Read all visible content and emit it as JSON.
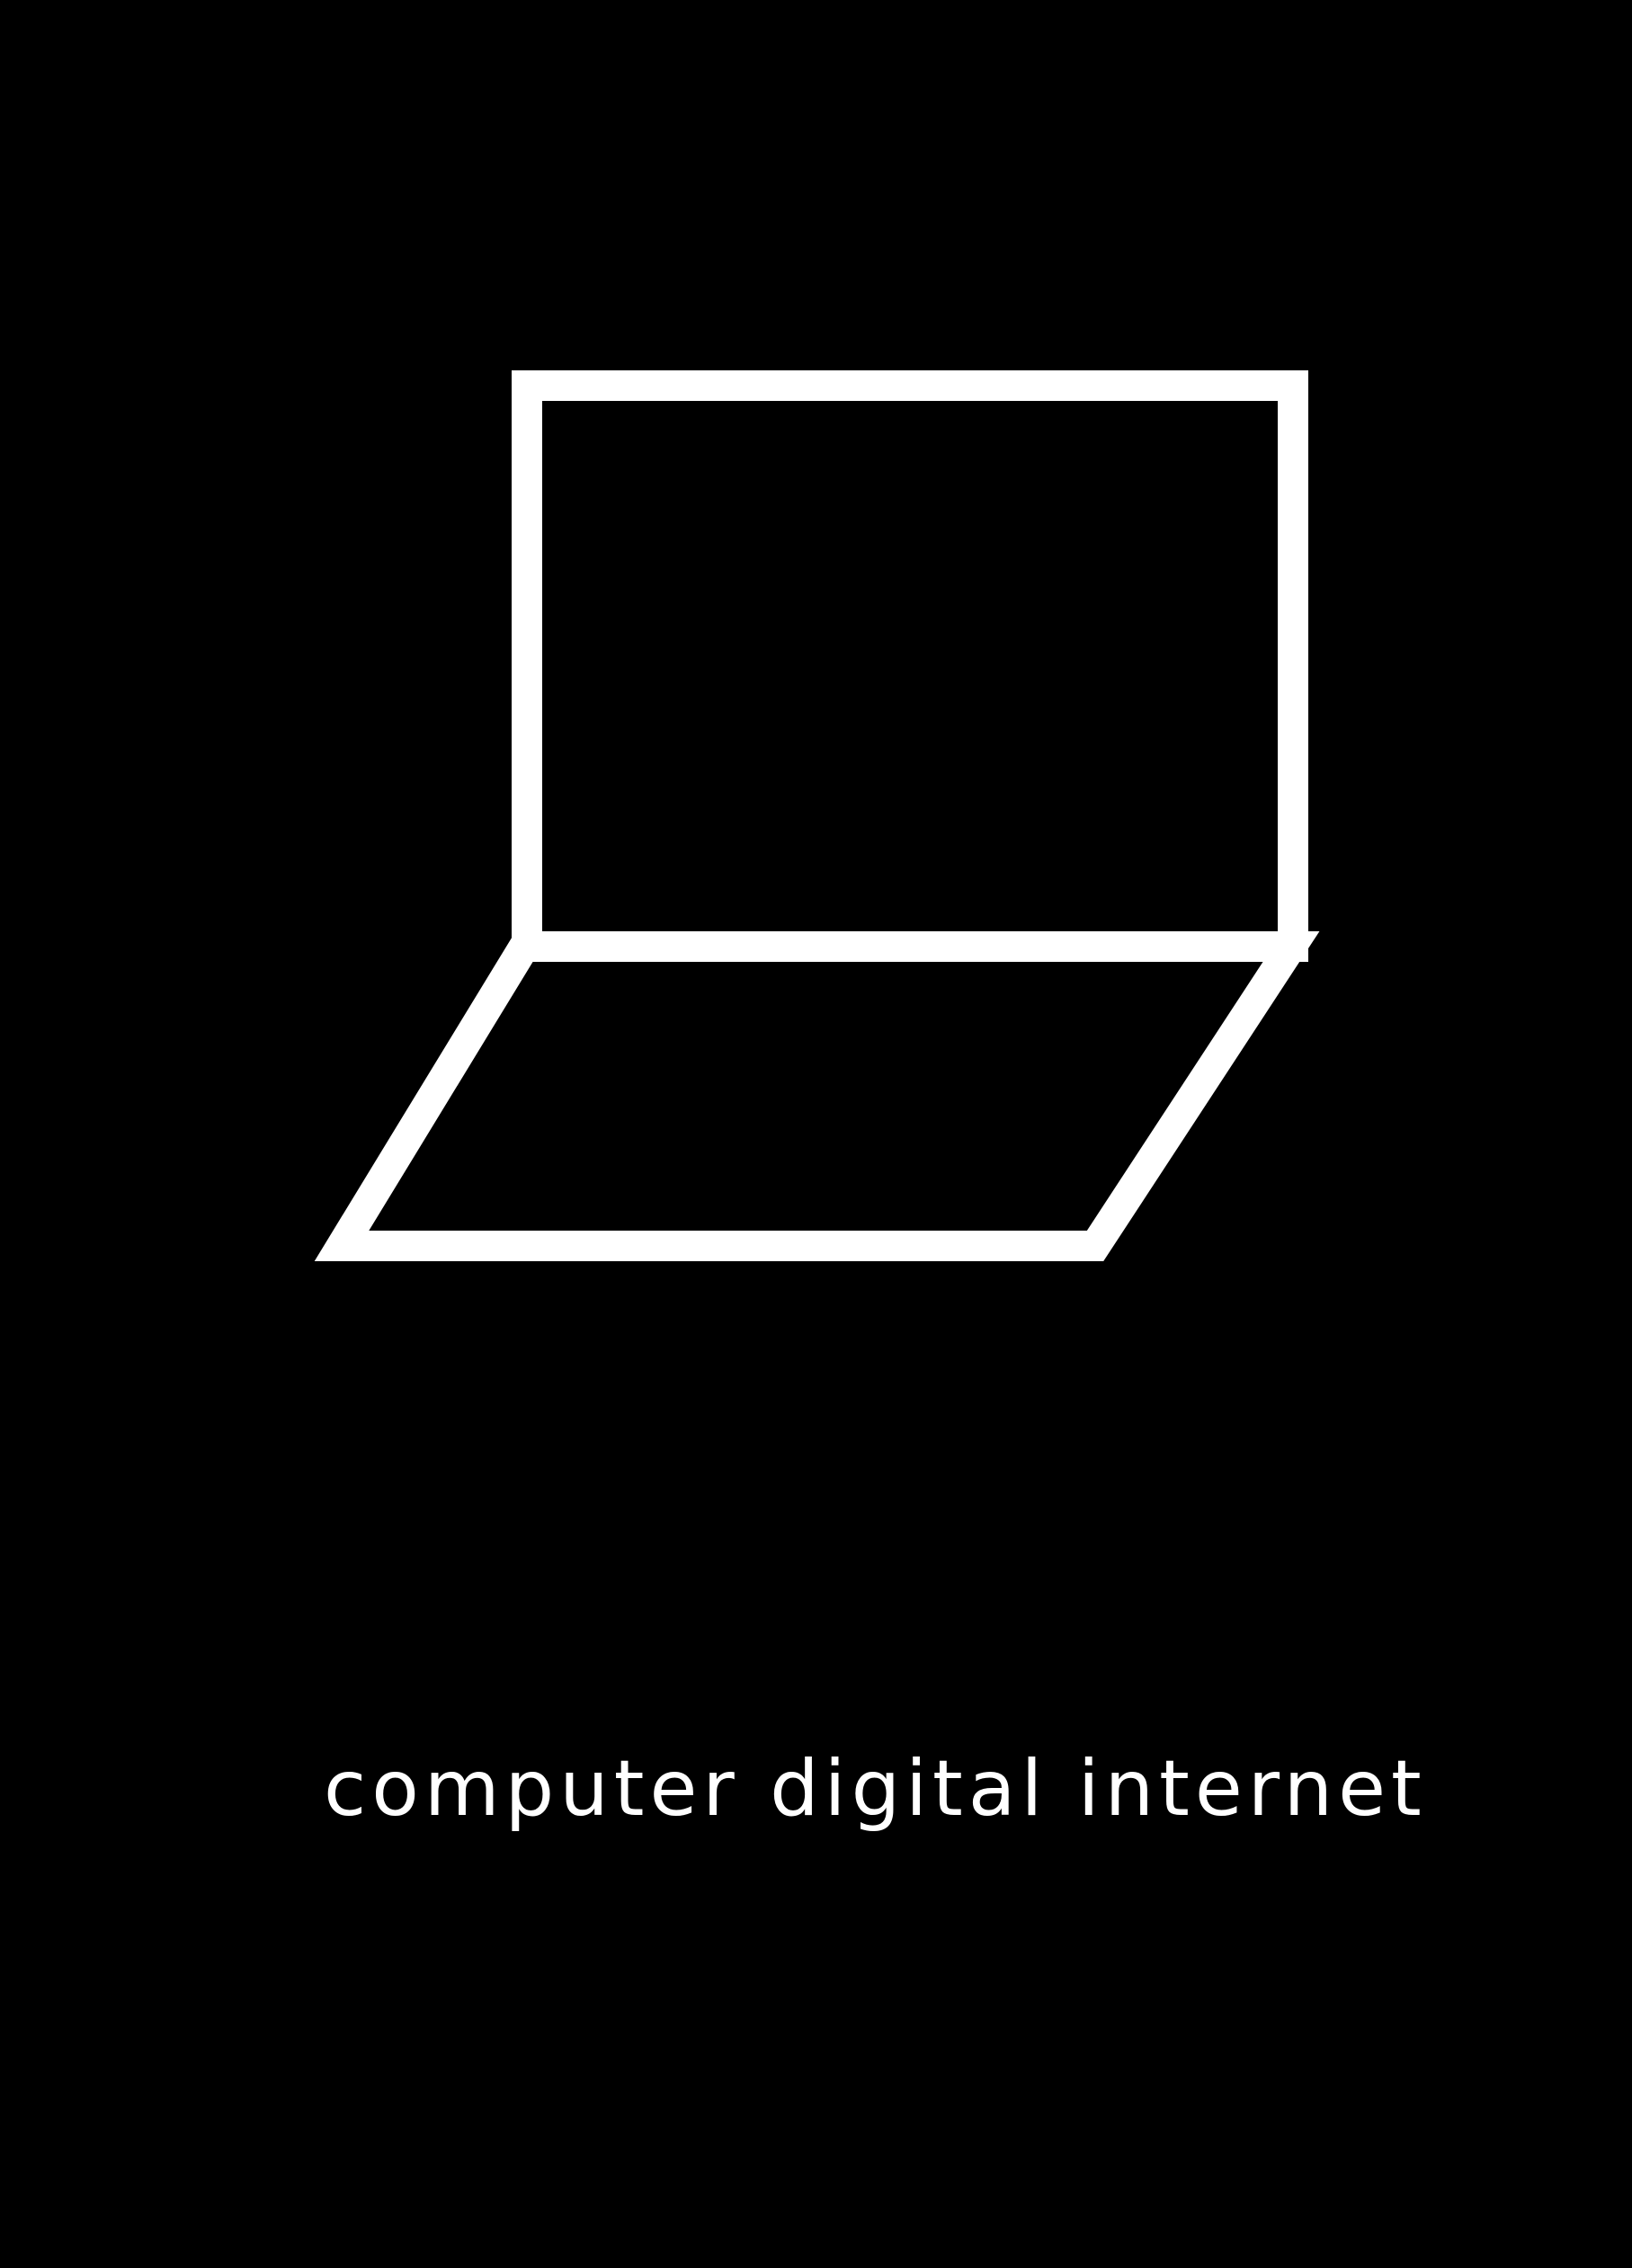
{
  "caption": "computer digital internet",
  "icon": "laptop-icon",
  "colors": {
    "background": "#000000",
    "foreground": "#ffffff"
  }
}
